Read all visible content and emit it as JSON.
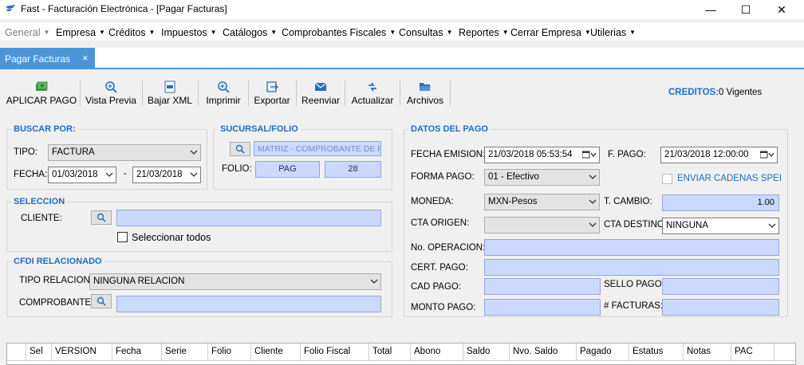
{
  "window": {
    "title": "Fast - Facturación Electrónica - [Pagar Facturas]",
    "controls": [
      "—",
      "☐",
      "✕"
    ]
  },
  "menu": [
    {
      "label": "General",
      "disabled": true
    },
    {
      "label": "Empresa"
    },
    {
      "label": "Créditos"
    },
    {
      "label": "Impuestos"
    },
    {
      "label": "Catálogos"
    },
    {
      "label": "Comprobantes Fiscales"
    },
    {
      "label": "Consultas"
    },
    {
      "label": "Reportes"
    },
    {
      "label": "Cerrar Empresa"
    },
    {
      "label": "Utilerias"
    }
  ],
  "tab": {
    "label": "Pagar Facturas",
    "close": "×"
  },
  "toolbar": {
    "aplicar_pago": "APLICAR PAGO",
    "vista_previa": "Vista Previa",
    "bajar_xml": "Bajar XML",
    "imprimir": "Imprimir",
    "exportar": "Exportar",
    "reenviar": "Reenviar",
    "actualizar": "Actualizar",
    "archivos": "Archivos"
  },
  "credits": {
    "label": "CREDITOS:",
    "value": "0 Vigentes"
  },
  "buscar": {
    "title": "BUSCAR POR:",
    "tipo_label": "TIPO:",
    "tipo_value": "FACTURA",
    "fecha_label": "FECHA:",
    "fecha_desde": "01/03/2018",
    "separator": "-",
    "fecha_hasta": "21/03/2018"
  },
  "sucursal": {
    "title": "SUCURSAL/FOLIO",
    "value": "MATRIZ - COMPROBANTE DE PAGO",
    "folio_label": "FOLIO:",
    "folio_serie": "PAG",
    "folio_num": "28"
  },
  "seleccion": {
    "title": "SELECCION",
    "cliente_label": "CLIENTE:",
    "cliente_value": "",
    "seleccionar_todos": "Seleccionar todos"
  },
  "cfdi": {
    "title": "CFDI RELACIONADO",
    "tipo_relacion_label": "TIPO RELACION:",
    "tipo_relacion_value": "NINGUNA RELACION",
    "comprobante_label": "COMPROBANTE:",
    "comprobante_value": ""
  },
  "pago": {
    "title": "DATOS DEL PAGO",
    "fecha_emision_label": "FECHA EMISION:",
    "fecha_emision_value": "21/03/2018 05:53:54",
    "f_pago_label": "F. PAGO:",
    "f_pago_value": "21/03/2018 12:00:00",
    "forma_pago_label": "FORMA PAGO:",
    "forma_pago_value": "01 - Efectivo",
    "enviar_spei": "ENVIAR CADENAS SPEI",
    "moneda_label": "MONEDA:",
    "moneda_value": "MXN-Pesos",
    "tcambio_label": "T. CAMBIO:",
    "tcambio_value": "1.00",
    "cta_origen_label": "CTA ORIGEN:",
    "cta_origen_value": "",
    "cta_destino_label": "CTA DESTINO:",
    "cta_destino_value": "NINGUNA",
    "no_operacion_label": "No. OPERACION:",
    "cert_pago_label": "CERT. PAGO:",
    "cad_pago_label": "CAD PAGO:",
    "sello_pago_label": "SELLO PAGO:",
    "monto_pago_label": "MONTO PAGO:",
    "num_facturas_label": "# FACTURAS:"
  },
  "grid": {
    "columns": [
      "Sel",
      "VERSION",
      "Fecha",
      "Serie",
      "Folio",
      "Cliente",
      "Folio Fiscal",
      "Total",
      "Abono",
      "Saldo",
      "Nvo. Saldo",
      "Pagado",
      "Estatus",
      "Notas",
      "PAC"
    ]
  },
  "colors": {
    "accent": "#1b6ec2",
    "tab": "#4a95d8",
    "field": "#ccd9ff"
  }
}
